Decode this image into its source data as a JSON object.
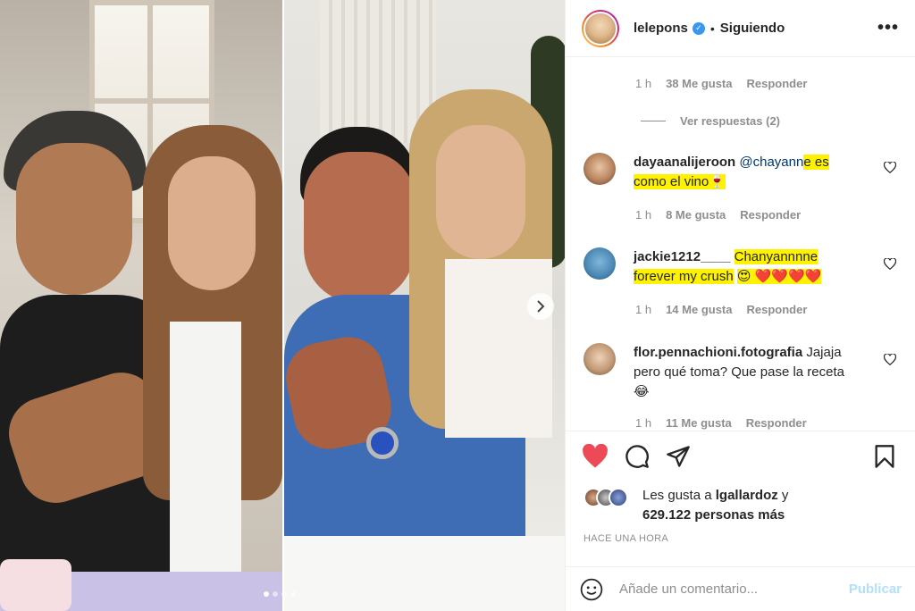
{
  "post": {
    "username": "lelepons",
    "follow_status": "Siguiendo",
    "dot": "•"
  },
  "top_meta": {
    "time": "1 h",
    "likes": "38 Me gusta",
    "reply": "Responder"
  },
  "view_replies": "Ver respuestas (2)",
  "comments": [
    {
      "user": "dayaanalijeroon",
      "mention": "@chayann",
      "text_highlight_1": "e es",
      "text_highlight_2": "como el vino",
      "emoji": "🍷",
      "time": "1 h",
      "likes": "8 Me gusta",
      "reply": "Responder"
    },
    {
      "user": "jackie1212____",
      "text_highlight_1": "Chanyannnne",
      "text_highlight_2": "forever my crush",
      "emoji": "😍 ❤️❤️❤️❤️",
      "time": "1 h",
      "likes": "14 Me gusta",
      "reply": "Responder"
    },
    {
      "user": "flor.pennachioni.fotografia",
      "text": "Jajaja pero qué toma? Que pase la receta",
      "emoji": "😂",
      "time": "1 h",
      "likes": "11 Me gusta",
      "reply": "Responder"
    }
  ],
  "likes": {
    "prefix": "Les gusta a",
    "first_user": "lgallardoz",
    "connector": "y",
    "others": "629.122 personas más"
  },
  "time_ago": "HACE UNA HORA",
  "add_comment": {
    "placeholder": "Añade un comentario...",
    "publish": "Publicar"
  },
  "icons": {
    "like": "heart-filled-icon",
    "comment": "comment-bubble-icon",
    "share": "paper-plane-icon",
    "save": "bookmark-icon",
    "more": "more-horizontal-icon",
    "emoji": "emoji-smile-icon",
    "next": "chevron-right-icon",
    "verified": "verified-badge-icon"
  },
  "colors": {
    "like_red": "#ed4956",
    "highlight": "#fff200",
    "link": "#00376b",
    "publish_disabled": "#b2dffc"
  },
  "carousel": {
    "slide_count": 4,
    "active_index": 0
  }
}
